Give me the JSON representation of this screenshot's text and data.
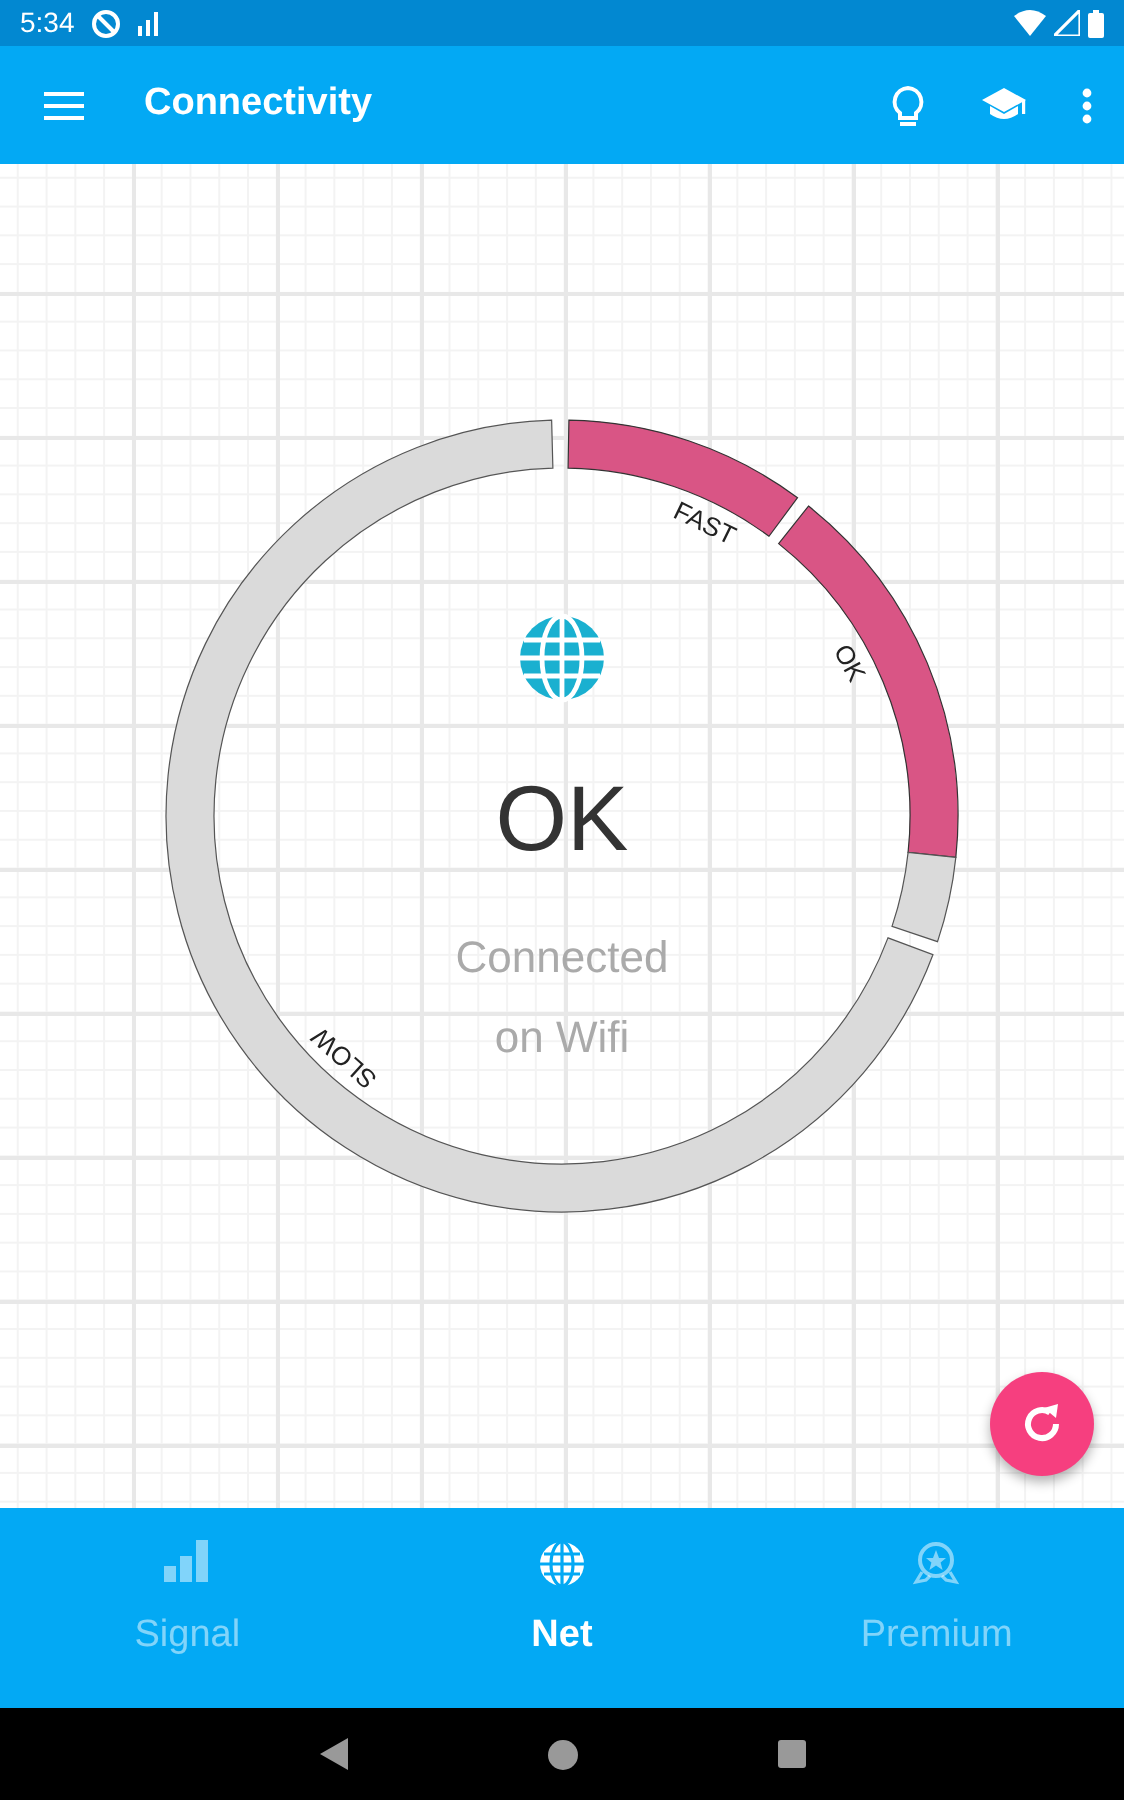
{
  "status_bar": {
    "time": "5:34"
  },
  "app_bar": {
    "title": "Connectivity"
  },
  "gauge": {
    "status": "OK",
    "caption_lines": [
      "Connected",
      "on Wifi"
    ],
    "segments": [
      {
        "label": "FAST"
      },
      {
        "label": "OK"
      },
      {
        "label": "SLOW"
      }
    ]
  },
  "bottom_nav": [
    {
      "label": "Signal",
      "kind": "signal",
      "selected": false
    },
    {
      "label": "Net",
      "kind": "net",
      "selected": true
    },
    {
      "label": "Premium",
      "kind": "premium",
      "selected": false
    }
  ]
}
